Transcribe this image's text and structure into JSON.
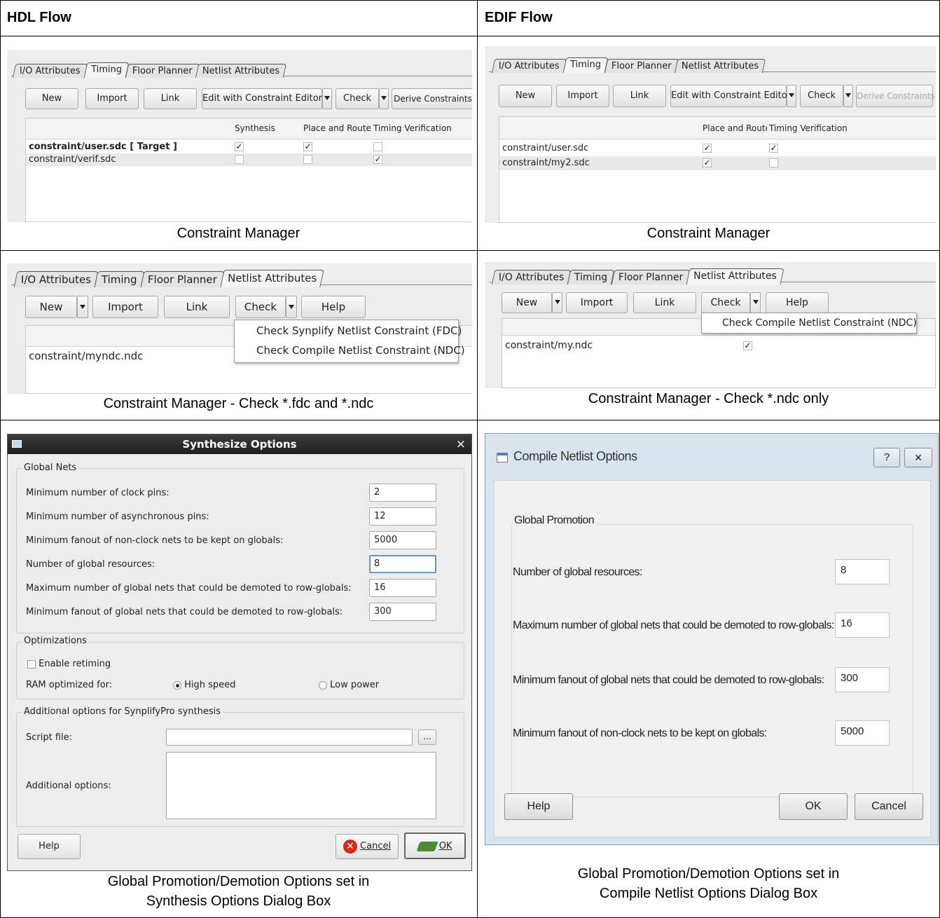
{
  "headers": {
    "left": "HDL Flow",
    "right": "EDIF Flow"
  },
  "captions": {
    "r1_left": "Constraint Manager",
    "r1_right": "Constraint Manager",
    "r2_left": "Constraint Manager - Check *.fdc and *.ndc",
    "r2_right": "Constraint Manager - Check *.ndc only",
    "r3_left_1": "Global Promotion/Demotion Options set in",
    "r3_left_2": "Synthesis Options Dialog Box",
    "r3_right_1": "Global Promotion/Demotion Options set in",
    "r3_right_2": "Compile Netlist Options Dialog Box"
  },
  "tabs": {
    "io": "I/O Attributes",
    "timing": "Timing",
    "floor": "Floor Planner",
    "netlist": "Netlist Attributes"
  },
  "buttons": {
    "new": "New",
    "import": "Import",
    "link": "Link",
    "edit_constraint": "Edit with Constraint Editor",
    "check": "Check",
    "derive": "Derive Constraints",
    "help": "Help"
  },
  "timing_hdl": {
    "columns": {
      "synthesis": "Synthesis",
      "place_route": "Place and Route",
      "timing_verif": "Timing Verification"
    },
    "rows": [
      {
        "file": "constraint/user.sdc  [ Target ]",
        "synthesis": true,
        "place_route": true,
        "timing_verif": false
      },
      {
        "file": "constraint/verif.sdc",
        "synthesis": false,
        "place_route": false,
        "timing_verif": true
      }
    ]
  },
  "timing_edif": {
    "columns": {
      "place_route": "Place and Route",
      "timing_verif": "Timing Verification"
    },
    "rows": [
      {
        "file": "constraint/user.sdc",
        "place_route": true,
        "timing_verif": true
      },
      {
        "file": "constraint/my2.sdc",
        "place_route": true,
        "timing_verif": false
      }
    ]
  },
  "netlist_hdl": {
    "file": "constraint/myndc.ndc",
    "menu": [
      "Check Synplify Netlist Constraint (FDC)",
      "Check Compile Netlist Constraint (NDC)"
    ]
  },
  "netlist_edif": {
    "file": "constraint/my.ndc",
    "checked": true,
    "menu": [
      "Check Compile Netlist Constraint (NDC)"
    ]
  },
  "synth": {
    "title": "Synthesize Options",
    "global_nets_legend": "Global Nets",
    "fields": [
      {
        "label": "Minimum number of clock pins:",
        "value": "2"
      },
      {
        "label": "Minimum number of asynchronous pins:",
        "value": "12"
      },
      {
        "label": "Minimum fanout of non-clock nets to be kept on globals:",
        "value": "5000"
      },
      {
        "label": "Number of global resources:",
        "value": "8"
      },
      {
        "label": "Maximum number of global nets that could be demoted to row-globals:",
        "value": "16"
      },
      {
        "label": "Minimum fanout of global nets that could be demoted to row-globals:",
        "value": "300"
      }
    ],
    "optim_legend": "Optimizations",
    "retiming": "Enable retiming",
    "retiming_checked": false,
    "ram_label": "RAM optimized for:",
    "ram_options": [
      "High speed",
      "Low power"
    ],
    "ram_selected": "High speed",
    "additional_legend": "Additional options for SynplifyPro synthesis",
    "script_label": "Script file:",
    "script_value": "",
    "browse": "...",
    "additional_label": "Additional options:",
    "additional_value": "",
    "help": "Help",
    "cancel": "Cancel",
    "ok": "OK",
    "close": "×"
  },
  "compile": {
    "title": "Compile Netlist Options",
    "legend": "Global Promotion",
    "fields": [
      {
        "label": "Number of global resources:",
        "value": "8"
      },
      {
        "label": "Maximum number of global nets that could be demoted to row-globals:",
        "value": "16"
      },
      {
        "label": "Minimum fanout of global nets that could be demoted to row-globals:",
        "value": "300"
      },
      {
        "label": "Minimum fanout of non-clock nets to be kept on globals:",
        "value": "5000"
      }
    ],
    "help": "Help",
    "ok": "OK",
    "cancel": "Cancel",
    "help_icon": "?",
    "close_icon": "✕"
  },
  "colors": {
    "border": "#000000",
    "dialog_bg": "#ededed",
    "titlebar": "#2a2a2a",
    "cancel_red": "#d9261c",
    "ok_green": "#4f8a3a"
  }
}
